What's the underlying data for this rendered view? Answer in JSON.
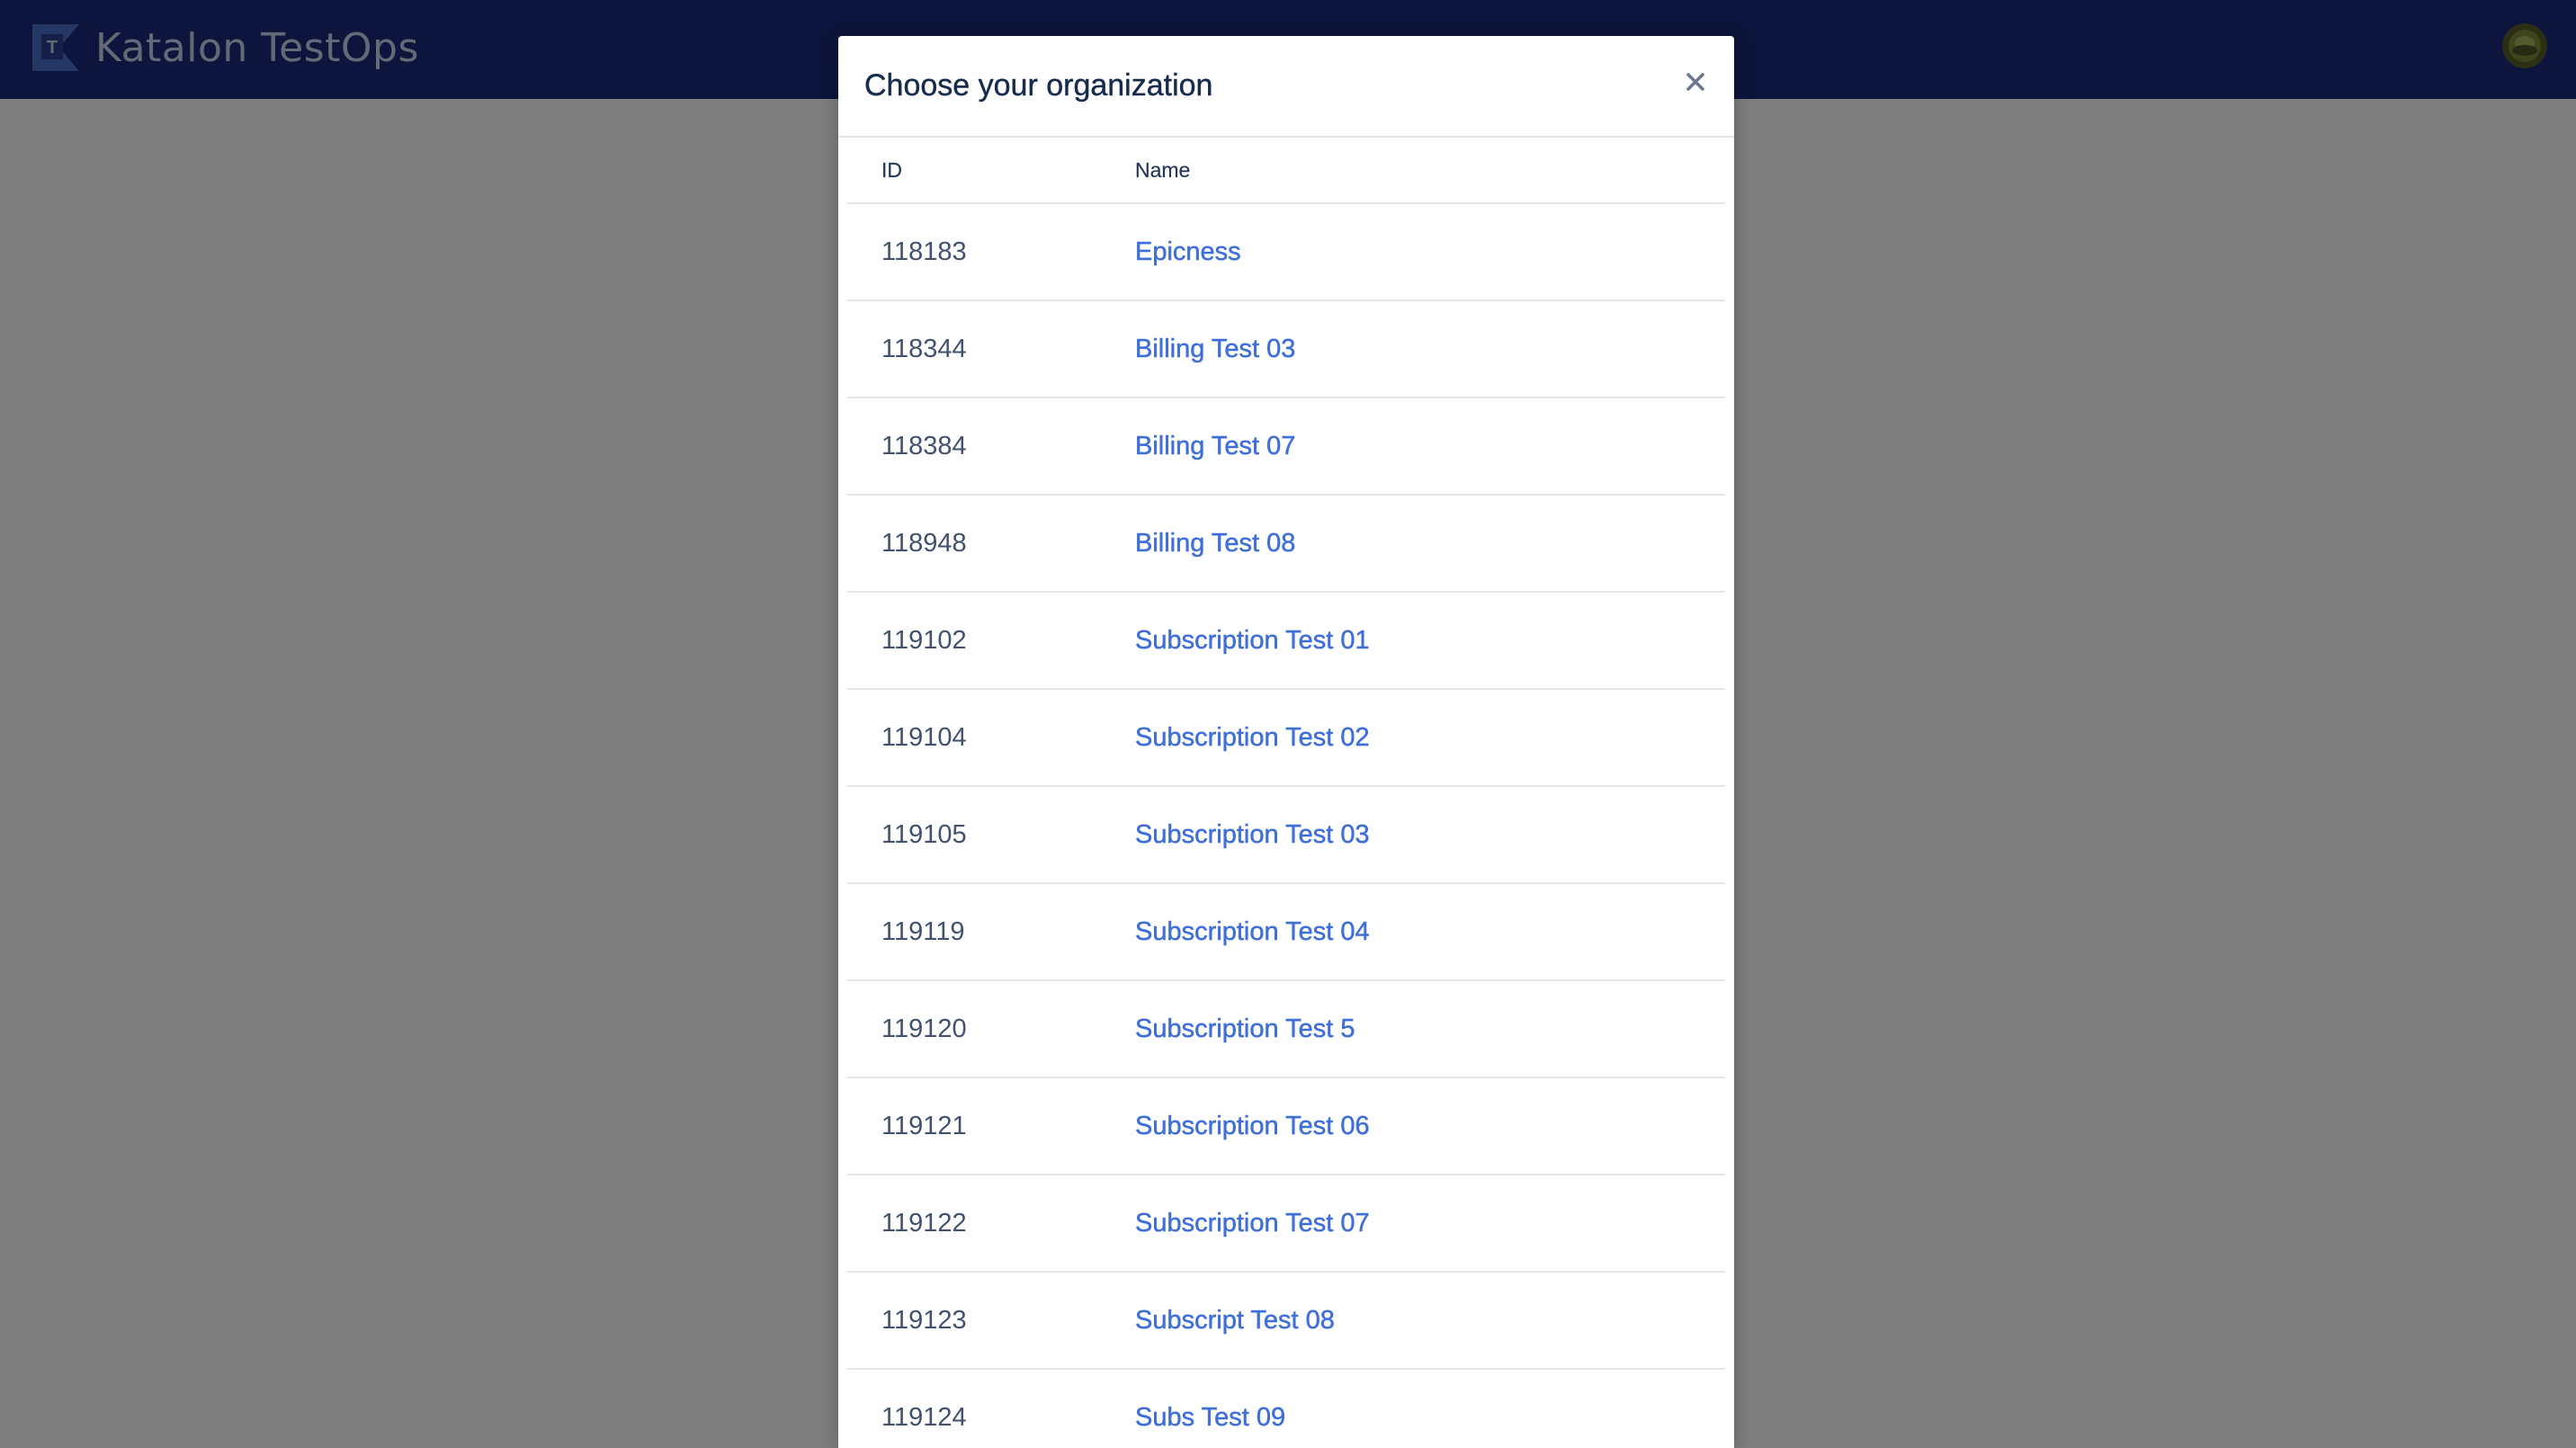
{
  "app": {
    "name": "Katalon TestOps",
    "logo_icon": "katalon-logo-icon",
    "avatar_icon": "user-avatar-icon"
  },
  "colors": {
    "topbar": "#1b2a78",
    "link": "#3f6fd8",
    "overlay": "rgba(0,0,0,0.5)"
  },
  "modal": {
    "title": "Choose your organization",
    "close_icon": "close-icon",
    "table": {
      "columns": [
        "ID",
        "Name"
      ],
      "rows": [
        {
          "id": "118183",
          "name": "Epicness"
        },
        {
          "id": "118344",
          "name": "Billing Test 03"
        },
        {
          "id": "118384",
          "name": "Billing Test 07"
        },
        {
          "id": "118948",
          "name": "Billing Test 08"
        },
        {
          "id": "119102",
          "name": "Subscription Test 01"
        },
        {
          "id": "119104",
          "name": "Subscription Test 02"
        },
        {
          "id": "119105",
          "name": "Subscription Test 03"
        },
        {
          "id": "119119",
          "name": "Subscription Test 04"
        },
        {
          "id": "119120",
          "name": "Subscription Test 5"
        },
        {
          "id": "119121",
          "name": "Subscription Test 06"
        },
        {
          "id": "119122",
          "name": "Subscription Test 07"
        },
        {
          "id": "119123",
          "name": "Subscript Test 08"
        },
        {
          "id": "119124",
          "name": "Subs Test 09"
        }
      ]
    }
  }
}
